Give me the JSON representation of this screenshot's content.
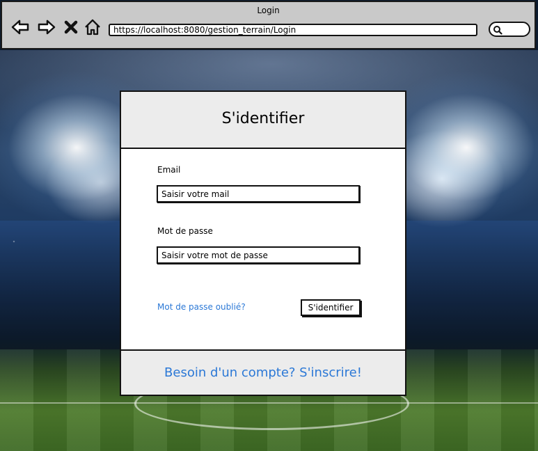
{
  "window": {
    "title": "Login"
  },
  "toolbar": {
    "back_icon": "arrow-left-icon",
    "forward_icon": "arrow-right-icon",
    "stop_icon": "close-icon",
    "home_icon": "home-icon",
    "url": "https://localhost:8080/gestion_terrain/Login",
    "search_icon": "search-icon"
  },
  "login": {
    "title": "S'identifier",
    "email_label": "Email",
    "email_placeholder": "Saisir votre mail",
    "password_label": "Mot de passe",
    "password_placeholder": "Saisir votre mot de passe",
    "forgot_link": "Mot de passe oublié?",
    "submit_label": "S'identifier",
    "signup_link": "Besoin d'un compte? S'inscrire!"
  },
  "colors": {
    "link": "#2b78d6",
    "panel_header": "#ececec",
    "chrome": "#c9c9c9"
  }
}
